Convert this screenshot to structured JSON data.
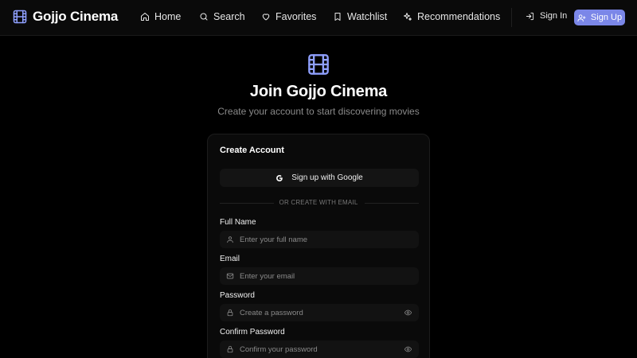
{
  "nav": {
    "brand_title": "Gojjo Cinema",
    "links": [
      {
        "label": "Home",
        "icon": "home-icon"
      },
      {
        "label": "Search",
        "icon": "search-icon"
      },
      {
        "label": "Favorites",
        "icon": "heart-icon"
      },
      {
        "label": "Watchlist",
        "icon": "bookmark-icon"
      },
      {
        "label": "Recommendations",
        "icon": "sparkles-icon"
      }
    ],
    "signin_label": "Sign In",
    "signup_label": "Sign Up"
  },
  "hero": {
    "icon": "film-icon",
    "title": "Join Gojjo Cinema",
    "subtitle": "Create your account to start discovering movies"
  },
  "form": {
    "card_title": "Create Account",
    "google_label": "Sign up with Google",
    "divider": "OR CREATE WITH EMAIL",
    "fields": {
      "full_name": {
        "label": "Full Name",
        "placeholder": "Enter your full name",
        "icon": "user-icon"
      },
      "email": {
        "label": "Email",
        "placeholder": "Enter your email",
        "icon": "mail-icon"
      },
      "password": {
        "label": "Password",
        "placeholder": "Create a password",
        "icon": "lock-icon"
      },
      "confirm_password": {
        "label": "Confirm Password",
        "placeholder": "Confirm your password",
        "icon": "lock-icon"
      }
    }
  },
  "colors": {
    "accent": "#7b87e8",
    "background": "#000000",
    "card": "#0a0a0a",
    "input": "#121212"
  }
}
